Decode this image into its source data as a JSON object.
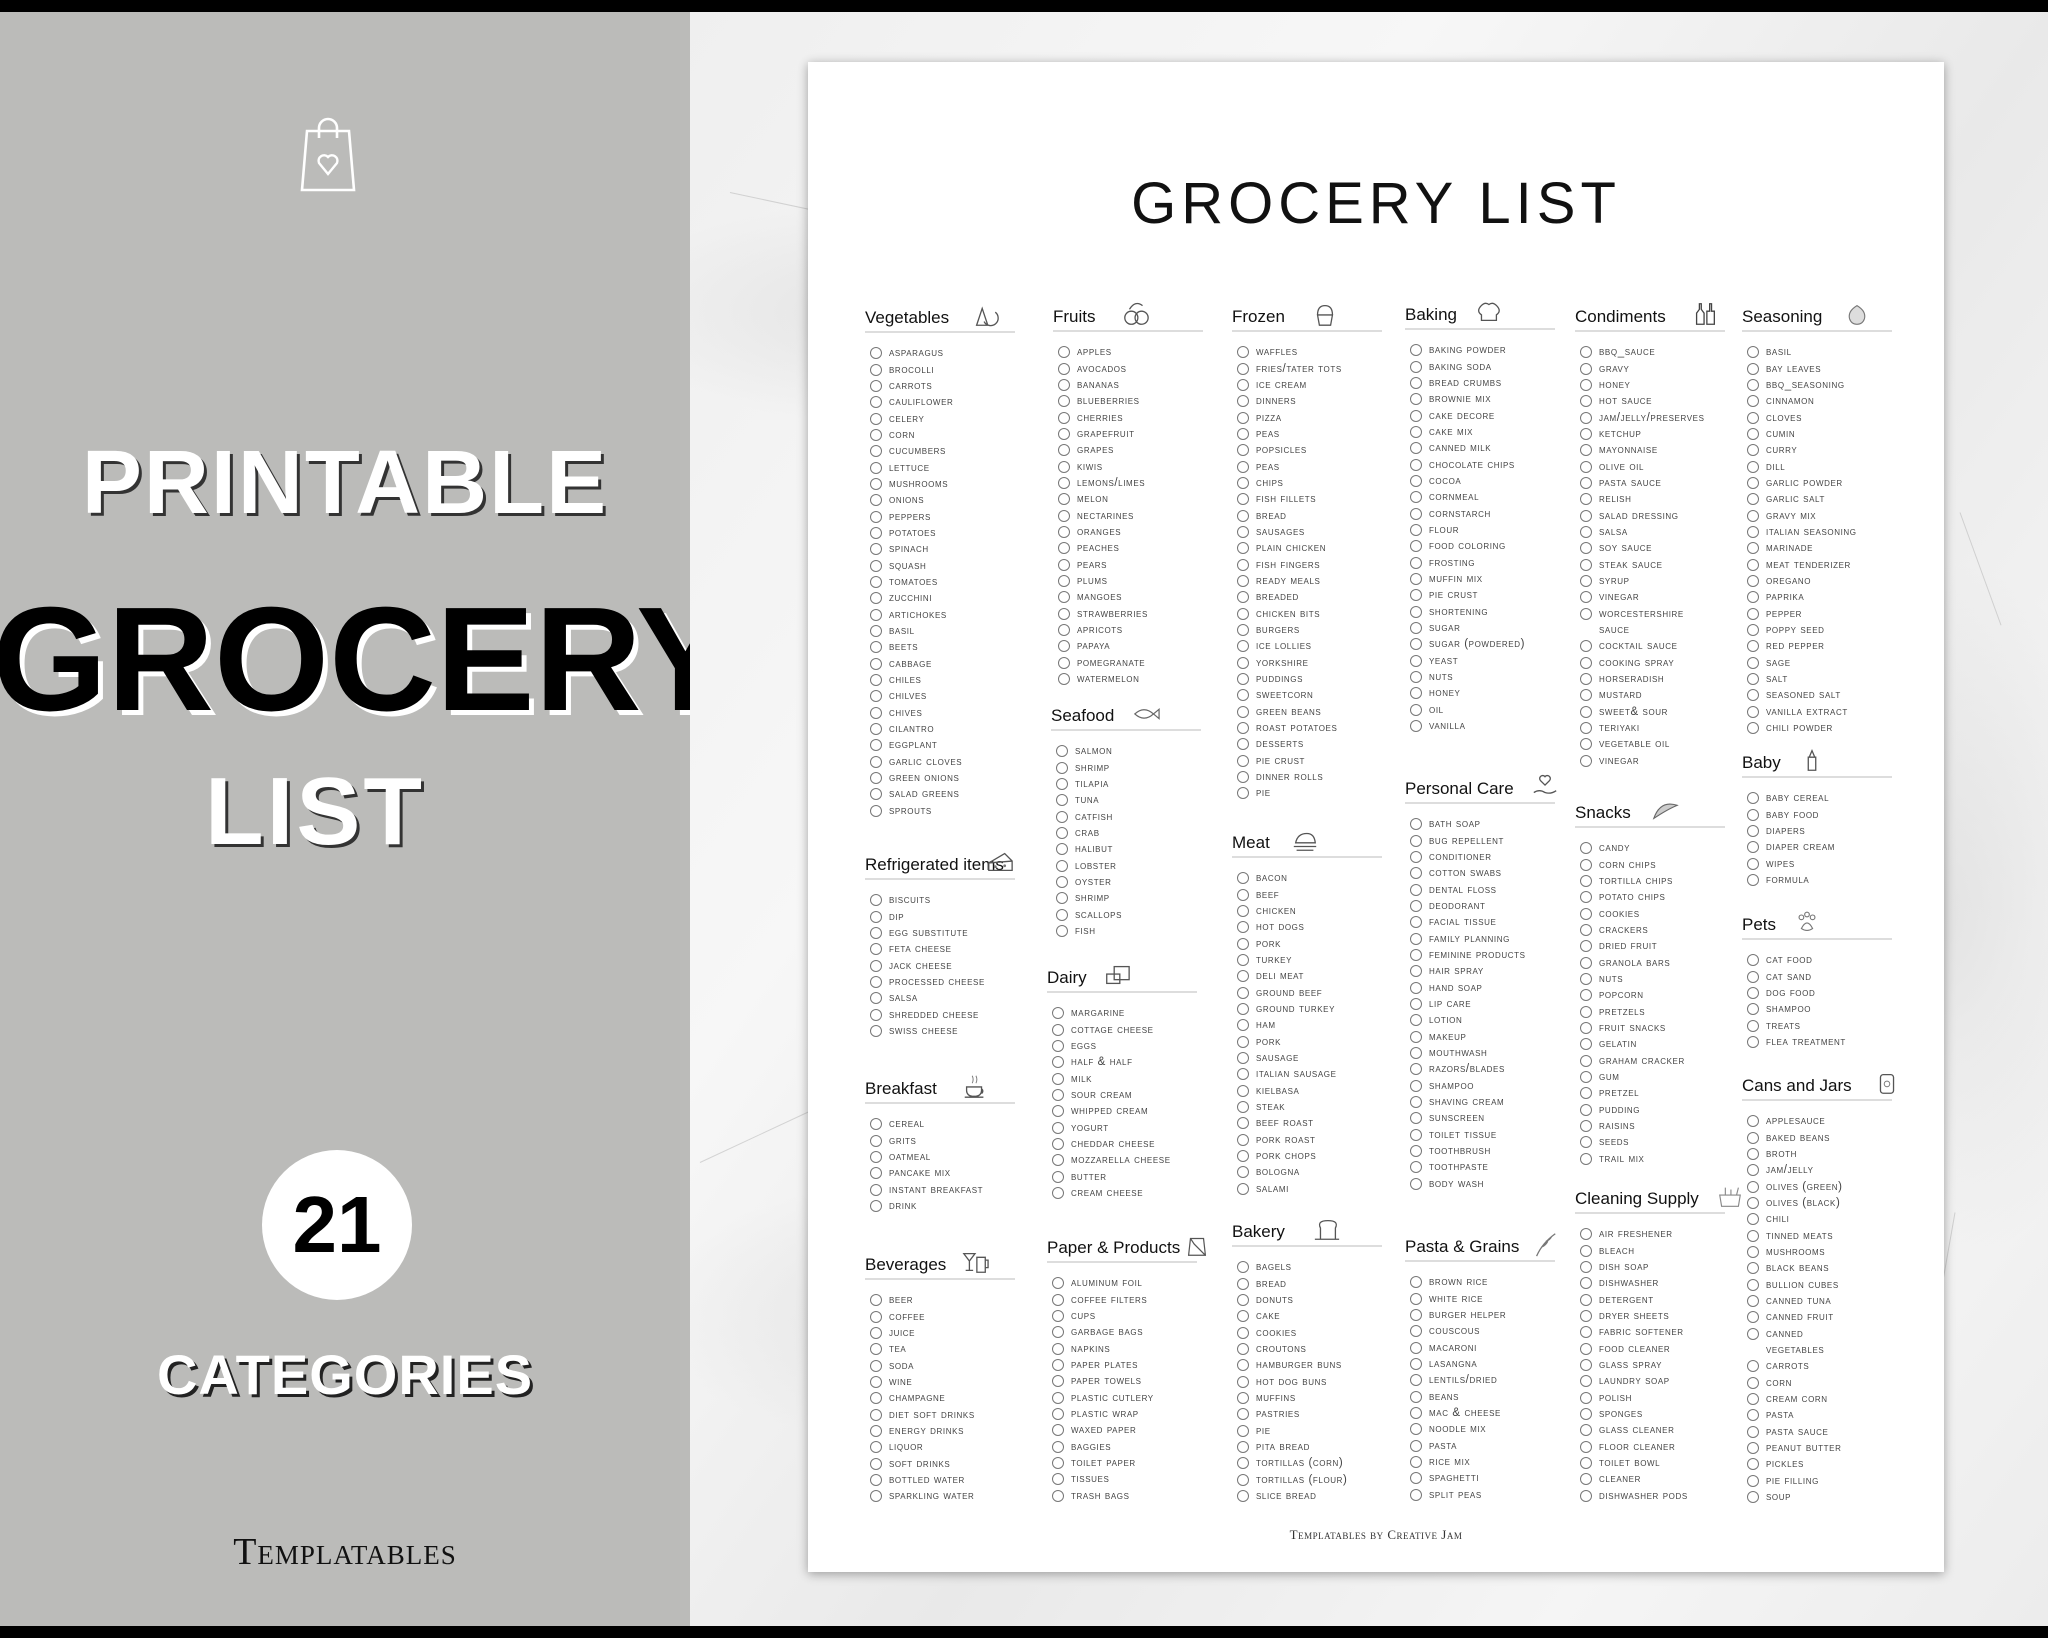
{
  "promo": {
    "line1": "PRINTABLE",
    "line2": "GROCERY",
    "line3": "LIST",
    "count": "21",
    "count_label": "CATEGORIES",
    "brand": "Templatables",
    "panel_color": "#bbbbb9"
  },
  "paper": {
    "title": "GROCERY LIST",
    "footer": "Templatables by Creative Jam",
    "sections": [
      {
        "title": "Vegetables",
        "icon": "vegetables-icon",
        "items": [
          "Asparagus",
          "Brocolli",
          "Carrots",
          "Cauliflower",
          "Celery",
          "Corn",
          "Cucumbers",
          "Lettuce",
          "Mushrooms",
          "Onions",
          "Peppers",
          "Potatoes",
          "Spinach",
          "Squash",
          "Tomatoes",
          "Zucchini",
          "Artichokes",
          "Basil",
          "Beets",
          "Cabbage",
          "Chiles",
          "Chilves",
          "Chives",
          "Cilantro",
          "Eggplant",
          "Garlic cloves",
          "Green onions",
          "Salad greens",
          "Sprouts"
        ]
      },
      {
        "title": "Refrigerated items",
        "icon": "cheese-icon",
        "items": [
          "Biscuits",
          "Dip",
          "Egg substitute",
          "Feta cheese",
          "Jack cheese",
          "Processed cheese",
          "Salsa",
          "Shredded cheese",
          "Swiss cheese"
        ]
      },
      {
        "title": "Breakfast",
        "icon": "coffee-cup-icon",
        "items": [
          "Cereal",
          "Grits",
          "Oatmeal",
          "Pancake Mix",
          "Instant breakfast",
          "drink"
        ]
      },
      {
        "title": "Beverages",
        "icon": "drinks-icon",
        "items": [
          "Beer",
          "Coffee",
          "Juice",
          "Tea",
          "Soda",
          "Wine",
          "Champagne",
          "Diet soft drinks",
          "Energy drinks",
          "Liquor",
          "Soft drinks",
          "Bottled water",
          "Sparkling water"
        ]
      },
      {
        "title": "Fruits",
        "icon": "fruits-icon",
        "items": [
          "Apples",
          "Avocados",
          "Bananas",
          "blueBerries",
          "Cherries",
          "Grapefruit",
          "Grapes",
          "Kiwis",
          "Lemons/limes",
          "Melon",
          "Nectarines",
          "Oranges",
          "Peaches",
          "Pears",
          "Plums",
          "Mangoes",
          "Strawberries",
          "Apricots",
          "Papaya",
          "Pomegranate",
          "Watermelon"
        ]
      },
      {
        "title": "Seafood",
        "icon": "fish-icon",
        "items": [
          "Salmon",
          "Shrimp",
          "Tilapia",
          "Tuna",
          "Catfish",
          "Crab",
          "Halibut",
          "Lobster",
          "Oyster",
          "Shrimp",
          "Scallops",
          "Fish"
        ]
      },
      {
        "title": "Dairy",
        "icon": "dairy-icon",
        "items": [
          "Margarine",
          "Cottage cheese",
          "Eggs",
          "Half & half",
          "Milk",
          "Sour Cream",
          "Whipped Cream",
          "Yogurt",
          "Cheddar Cheese",
          "Mozzarella Cheese",
          "Butter",
          "Cream Cheese"
        ]
      },
      {
        "title": "Paper & Products",
        "icon": "paper-bag-icon",
        "items": [
          "Aluminum foil",
          "Coffee filters",
          "Cups",
          "Garbage bags",
          "Napkins",
          "Paper plates",
          "Paper towels",
          "Plastic cutlery",
          "Plastic wrap",
          "Waxed paper",
          "Baggies",
          "Toilet Paper",
          "Tissues",
          "Trash bags"
        ]
      },
      {
        "title": "Frozen",
        "icon": "cupcake-icon",
        "items": [
          "Waffles",
          "Fries/Tater Tots",
          "Ice cream",
          "Dinners",
          "Pizza",
          "Peas",
          "Popsicles",
          "Peas",
          "Chips",
          "Fish Fillets",
          "Bread",
          "Sausages",
          "Plain Chicken",
          "Fish Fingers",
          "Ready meals",
          "Breaded",
          "Chicken bits",
          "Burgers",
          "Ice lollies",
          "Yorkshire",
          "Puddings",
          "Sweetcorn",
          "Green Beans",
          "Roast Potatoes",
          "Desserts",
          "Pie Crust",
          "Dinner rolls",
          "Pie"
        ]
      },
      {
        "title": "Meat",
        "icon": "roast-chicken-icon",
        "items": [
          "Bacon",
          "Beef",
          "Chicken",
          "Hot dogs",
          "Pork",
          "Turkey",
          "Deli meat",
          "Ground beef",
          "Ground Turkey",
          "Ham",
          "Pork",
          "Sausage",
          "Italian Sausage",
          "Kielbasa",
          "Steak",
          "Beef Roast",
          "Pork Roast",
          "Pork Chops",
          "Bologna",
          "Salami"
        ]
      },
      {
        "title": "Bakery",
        "icon": "bread-icon",
        "items": [
          "Bagels",
          "Bread",
          "Donuts",
          "Cake",
          "Cookies",
          "Croutons",
          "Hamburger buns",
          "Hot dog buns",
          "Muffins",
          "Pastries",
          "Pie",
          "Pita Bread",
          "Tortillas (corn)",
          "Tortillas (flour)",
          "Slice bread"
        ]
      },
      {
        "title": "Baking",
        "icon": "chef-hat-icon",
        "items": [
          "Baking powder",
          "Baking soda",
          "Bread crumbs",
          "Brownie mix",
          "Cake decore",
          "Cake mix",
          "Canned milk",
          "Chocolate chips",
          "Cocoa",
          "Cornmeal",
          "Cornstarch",
          "Flour",
          "Food coloring",
          "Frosting",
          "Muffin mix",
          "Pie crust",
          "Shortening",
          "Sugar",
          "Sugar (powdered)",
          "Yeast",
          "Nuts",
          "Honey",
          "Oil",
          "vanilla"
        ]
      },
      {
        "title": "Personal Care",
        "icon": "hand-heart-icon",
        "items": [
          "Bath Soap",
          "Bug repellent",
          "Conditioner",
          "Cotton swabs",
          "Dental Floss",
          "Deodorant",
          "Facial tissue",
          "Family Planning",
          "Feminine Products",
          "Hair spray",
          "Hand soap",
          "Lip care",
          "Lotion",
          "Makeup",
          "Mouthwash",
          "Razors/blades",
          "Shampoo",
          "Shaving cream",
          "Sunscreen",
          "Toilet tissue",
          "Toothbrush",
          "Toothpaste",
          "Body wash"
        ]
      },
      {
        "title": "Pasta & Grains",
        "icon": "wheat-icon",
        "items": [
          "Brown rice",
          "White rice",
          "Burger helper",
          "Couscous",
          "Macaroni",
          "Lasangna",
          "Lentils/dried",
          "beans",
          "Mac & cheese",
          "Noodle mix",
          "Pasta",
          "Rice mix",
          "Spaghetti",
          "Split peas"
        ]
      },
      {
        "title": "Condiments",
        "icon": "condiment-bottles-icon",
        "items": [
          "BBQ_sauce",
          "Gravy",
          "Honey",
          "Hot sauce",
          "Jam/jelly/preserves",
          "Ketchup",
          "Mayonnaise",
          "Olive oil",
          "Pasta sauce",
          "Relish",
          "Salad dressing",
          "Salsa",
          "Soy sauce",
          "Steak sauce",
          "Syrup",
          "Vinegar",
          "Worcestershire",
          "~sauce",
          "Cocktail sauce",
          "Cooking spray",
          "Horseradish",
          "Mustard",
          "Sweet& Sour",
          "Teriyaki",
          "Vegetable oil",
          "Vinegar"
        ]
      },
      {
        "title": "Snacks",
        "icon": "taco-icon",
        "items": [
          "Candy",
          "Corn Chips",
          "Tortilla Chips",
          "Potato Chips",
          "Cookies",
          "Crackers",
          "Dried fruit",
          "Granola bars",
          "Nuts",
          "Popcorn",
          "Pretzels",
          "Fruit Snacks",
          "Gelatin",
          "Graham Cracker",
          "Gum",
          "Pretzel",
          "Pudding",
          "Raisins",
          "Seeds",
          "Trail Mix"
        ]
      },
      {
        "title": "Cleaning Supply",
        "icon": "cleaning-bucket-icon",
        "items": [
          "Air Freshener",
          "Bleach",
          "Dish Soap",
          "Dishwasher",
          "detergent",
          "Dryer sheets",
          "Fabric softener",
          "Food Cleaner",
          "Glass spray",
          "Laundry soap",
          "Polish",
          "Sponges",
          "Glass Cleaner",
          "Floor Cleaner",
          "Toilet Bowl",
          "Cleaner",
          "Dishwasher Pods"
        ]
      },
      {
        "title": "Seasoning",
        "icon": "onion-icon",
        "items": [
          "Basil",
          "Bay leaves",
          "BBQ_seasoning",
          "Cinnamon",
          "Cloves",
          "Cumin",
          "Curry",
          "Dill",
          "Garlic Powder",
          "Garlic salt",
          "Gravy mix",
          "Italian seasoning",
          "Marinade",
          "Meat tenderizer",
          "Oregano",
          "Paprika",
          "Pepper",
          "Poppy seed",
          "Red pepper",
          "Sage",
          "Salt",
          "Seasoned salt",
          "Vanilla extract",
          "Chili Powder"
        ]
      },
      {
        "title": "Baby",
        "icon": "baby-bottle-icon",
        "items": [
          "Baby Cereal",
          "Baby food",
          "Diapers",
          "Diaper cream",
          "Wipes",
          "Formula"
        ]
      },
      {
        "title": "Pets",
        "icon": "paw-icon",
        "items": [
          "Cat food",
          "Cat sand",
          "Dog food",
          "Shampoo",
          "Treats",
          "Flea treatment"
        ]
      },
      {
        "title": "Cans and Jars",
        "icon": "can-icon",
        "items": [
          "Applesauce",
          "Baked beans",
          "Broth",
          "Jam/jelly",
          "Olives (green)",
          "Olives (black)",
          "Chili",
          "Tinned meats",
          "Mushrooms",
          "Black beans",
          "Bullion cubes",
          "Canned Tuna",
          "Canned fruit",
          "Canned",
          "~vegetables",
          "Carrots",
          "Corn",
          "Cream corn",
          "Pasta",
          "Pasta sauce",
          "Peanut butter",
          "Pickles",
          "Pie filling",
          "Soup"
        ]
      }
    ]
  }
}
